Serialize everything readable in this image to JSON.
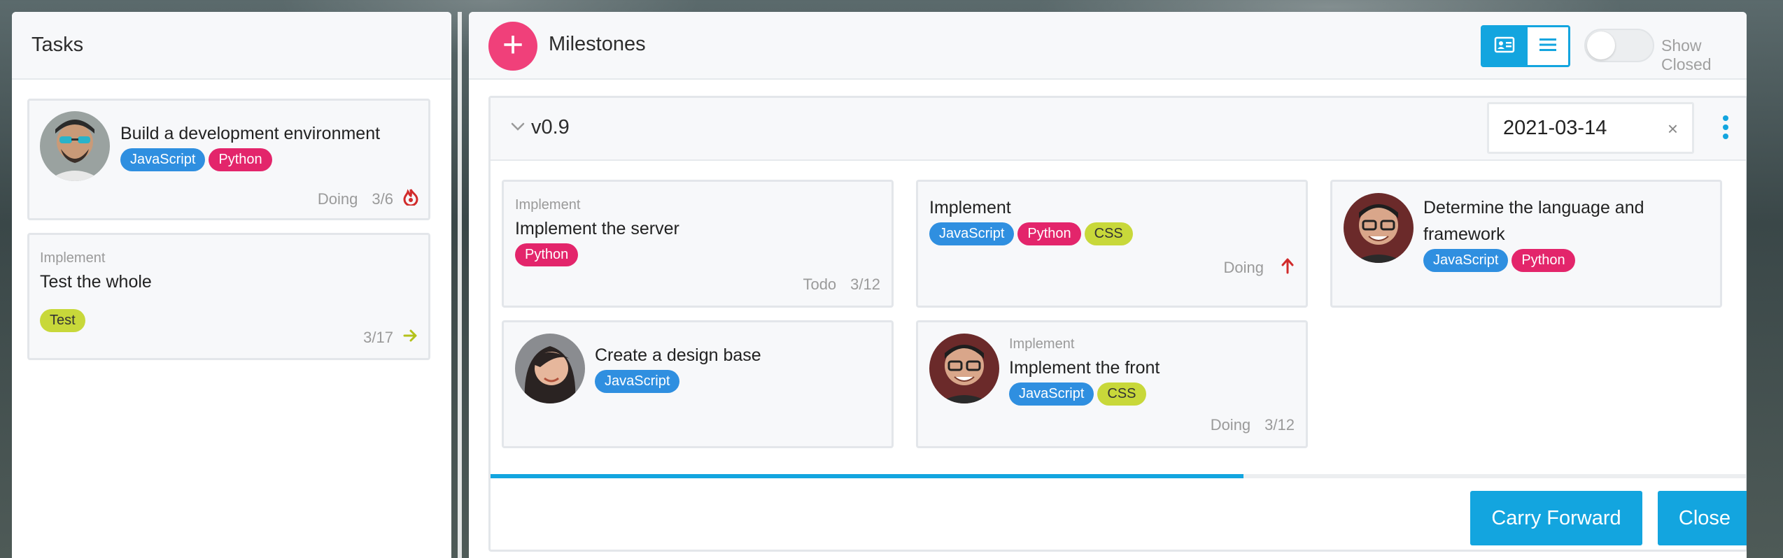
{
  "tasks": {
    "title": "Tasks",
    "cards": [
      {
        "title": "Build a development environment",
        "tags": [
          "JavaScript",
          "Python"
        ],
        "status": "Doing",
        "count": "3/6",
        "indicator": "fire-icon"
      },
      {
        "kicker": "Implement",
        "title": "Test the whole",
        "tags": [
          "Test"
        ],
        "count": "3/17",
        "indicator": "arrow-right-icon"
      }
    ]
  },
  "milestones": {
    "title": "Milestones",
    "add_label": "+",
    "show_closed_label": "Show Closed",
    "show_closed": false,
    "group": {
      "version": "v0.9",
      "date": "2021-03-14",
      "clear_label": "×",
      "progress": 0.6,
      "cards": [
        {
          "kicker": "Implement",
          "title": "Implement the server",
          "tags": [
            "Python"
          ],
          "status": "Todo",
          "count": "3/12"
        },
        {
          "title": "Implement",
          "tags": [
            "JavaScript",
            "Python",
            "CSS"
          ],
          "status": "Doing",
          "indicator": "arrow-up-icon"
        },
        {
          "title": "Determine the language and framework",
          "tags": [
            "JavaScript",
            "Python"
          ]
        },
        {
          "title": "Create a design base",
          "tags": [
            "JavaScript"
          ]
        },
        {
          "kicker": "Implement",
          "title": "Implement the front",
          "tags": [
            "JavaScript",
            "CSS"
          ],
          "status": "Doing",
          "count": "3/12"
        }
      ],
      "carry_forward_label": "Carry Forward",
      "close_label": "Close"
    }
  },
  "colors": {
    "accent": "#13a5df",
    "add": "#f0407a",
    "javascript": "#2f8fe0",
    "python": "#e3256b",
    "css": "#c8d83a"
  }
}
